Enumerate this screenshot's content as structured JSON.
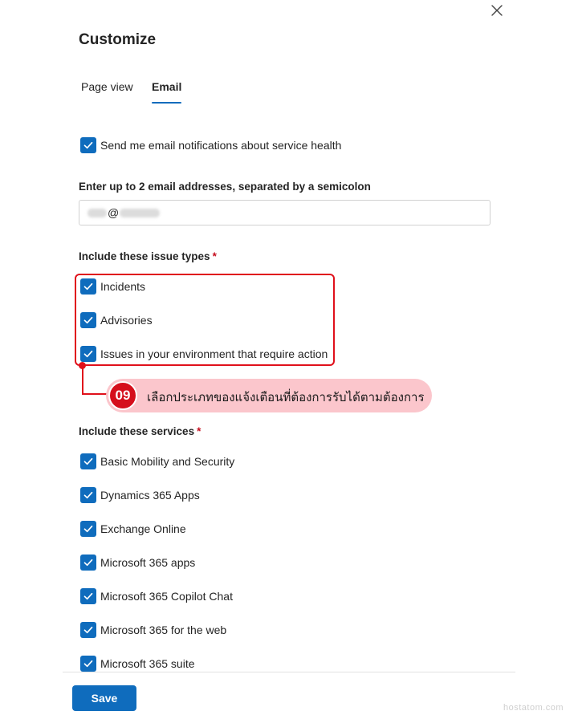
{
  "panel": {
    "title": "Customize",
    "close_icon": "close-icon"
  },
  "tabs": [
    {
      "label": "Page view",
      "selected": false
    },
    {
      "label": "Email",
      "selected": true
    }
  ],
  "notifications": {
    "send_label": "Send me email notifications about service health",
    "checked": true
  },
  "email": {
    "label": "Enter up to 2 email addresses, separated by a semicolon",
    "value_visible_char": "@"
  },
  "issue_types": {
    "label": "Include these issue types",
    "required_mark": "*",
    "items": [
      {
        "label": "Incidents",
        "checked": true
      },
      {
        "label": "Advisories",
        "checked": true
      },
      {
        "label": "Issues in your environment that require action",
        "checked": true
      }
    ]
  },
  "annotation": {
    "step": "09",
    "text": "เลือกประเภทของแจ้งเตือนที่ต้องการรับได้ตามต้องการ",
    "color": "#e0101b",
    "bg_color": "#fbc6cc"
  },
  "services": {
    "label": "Include these services",
    "required_mark": "*",
    "items": [
      {
        "label": "Basic Mobility and Security",
        "checked": true
      },
      {
        "label": "Dynamics 365 Apps",
        "checked": true
      },
      {
        "label": "Exchange Online",
        "checked": true
      },
      {
        "label": "Microsoft 365 apps",
        "checked": true
      },
      {
        "label": "Microsoft 365 Copilot Chat",
        "checked": true
      },
      {
        "label": "Microsoft 365 for the web",
        "checked": true
      },
      {
        "label": "Microsoft 365 suite",
        "checked": true
      }
    ]
  },
  "footer": {
    "save_label": "Save"
  },
  "watermark": "hostatom.com",
  "colors": {
    "accent": "#0f6cbd",
    "required": "#c50f1f"
  }
}
